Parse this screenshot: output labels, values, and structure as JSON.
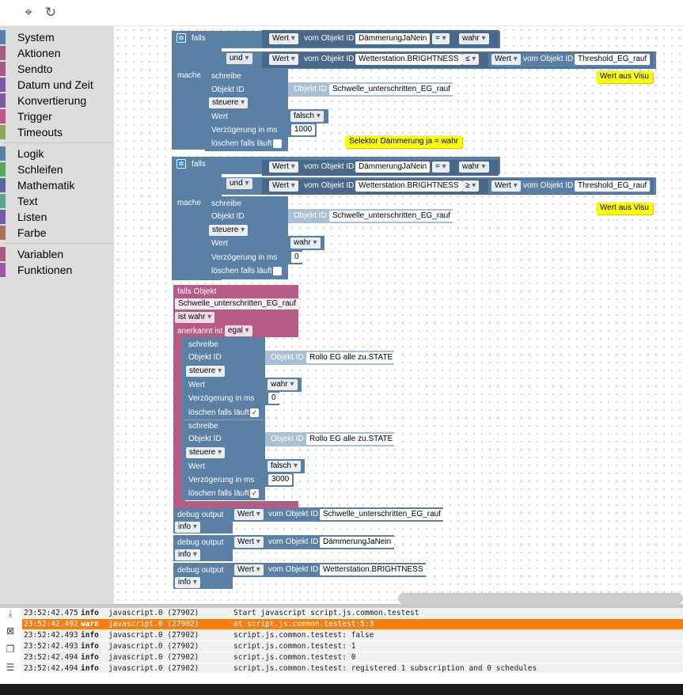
{
  "sidebar": {
    "groups": [
      [
        {
          "label": "System",
          "color": "#5b80a5"
        },
        {
          "label": "Aktionen",
          "color": "#a55b80"
        },
        {
          "label": "Sendto",
          "color": "#a55b80"
        },
        {
          "label": "Datum und Zeit",
          "color": "#7b5ba5"
        },
        {
          "label": "Konvertierung",
          "color": "#7b5ba5"
        },
        {
          "label": "Trigger",
          "color": "#b55b85"
        },
        {
          "label": "Timeouts",
          "color": "#8fa55b"
        }
      ],
      [
        {
          "label": "Logik",
          "color": "#5b80a5"
        },
        {
          "label": "Schleifen",
          "color": "#5ba55b"
        },
        {
          "label": "Mathematik",
          "color": "#5b67a5"
        },
        {
          "label": "Text",
          "color": "#5ba58c"
        },
        {
          "label": "Listen",
          "color": "#745ba5"
        },
        {
          "label": "Farbe",
          "color": "#a5745b"
        }
      ],
      [
        {
          "label": "Variablen",
          "color": "#a55b80"
        },
        {
          "label": "Funktionen",
          "color": "#995ba5"
        }
      ]
    ]
  },
  "blocks": {
    "if1": {
      "falls": "falls",
      "und": "und",
      "mache": "mache",
      "wert1": "Wert",
      "vom1": "vom Objekt ID",
      "obj1": "DämmerungJaNein",
      "op1": "=",
      "val1": "wahr",
      "wert2": "Wert",
      "vom2": "vom Objekt ID",
      "obj2": "Wetterstation.BRIGHTNESS",
      "op2": "≤",
      "wert3": "Wert",
      "vom3": "vom Objekt ID",
      "obj3": "Threshold_EG_rauf",
      "schreibe": "schreibe",
      "objektid": "Objekt ID",
      "objlabel": "Objekt ID",
      "objval": "Schwelle_unterschritten_EG_rauf",
      "steuere": "steuere",
      "wertlbl": "Wert",
      "wertval": "falsch",
      "verz": "Verzögerung in ms",
      "verzval": "1000",
      "loeschen": "löschen falls läuft"
    },
    "if2": {
      "falls": "falls",
      "und": "und",
      "mache": "mache",
      "wert1": "Wert",
      "vom1": "vom Objekt ID",
      "obj1": "DämmerungJaNein",
      "op1": "=",
      "val1": "wahr",
      "wert2": "Wert",
      "vom2": "vom Objekt ID",
      "obj2": "Wetterstation.BRIGHTNESS",
      "op2": "≥",
      "wert3": "Wert",
      "vom3": "vom Objekt ID",
      "obj3": "Threshold_EG_rauf",
      "schreibe": "schreibe",
      "objektid": "Objekt ID",
      "objlabel": "Objekt ID",
      "objval": "Schwelle_unterschritten_EG_rauf",
      "steuere": "steuere",
      "wertlbl": "Wert",
      "wertval": "wahr",
      "verz": "Verzögerung in ms",
      "verzval": "0",
      "loeschen": "löschen falls läuft"
    },
    "trigger": {
      "title": "falls Objekt",
      "obj": "Schwelle_unterschritten_EG_rauf",
      "cond": "ist wahr",
      "anerkannt": "anerkannt ist",
      "anerkanntval": "egal",
      "w1": {
        "schreibe": "schreibe",
        "objektid": "Objekt ID",
        "objlabel": "Objekt ID",
        "objval": "Rollo EG alle zu.STATE",
        "steuere": "steuere",
        "wertlbl": "Wert",
        "wertval": "wahr",
        "verz": "Verzögerung in ms",
        "verzval": "0",
        "loeschen": "löschen falls läuft"
      },
      "w2": {
        "schreibe": "schreibe",
        "objektid": "Objekt ID",
        "objlabel": "Objekt ID",
        "objval": "Rollo EG alle zu.STATE",
        "steuere": "steuere",
        "wertlbl": "Wert",
        "wertval": "falsch",
        "verz": "Verzögerung in ms",
        "verzval": "3000",
        "loeschen": "löschen falls läuft"
      }
    },
    "debug": [
      {
        "label": "debug output",
        "wert": "Wert",
        "vom": "vom Objekt ID",
        "obj": "Schwelle_unterschritten_EG_rauf",
        "level": "info"
      },
      {
        "label": "debug output",
        "wert": "Wert",
        "vom": "vom Objekt ID",
        "obj": "DämmerungJaNein",
        "level": "info"
      },
      {
        "label": "debug output",
        "wert": "Wert",
        "vom": "vom Objekt ID",
        "obj": "Wetterstation.BRIGHTNESS",
        "level": "info"
      }
    ]
  },
  "notes": {
    "n1": "Wert aus Visu",
    "n2": "Selektor Dämmerung ja = wahr",
    "n3": "Wert aus Visu"
  },
  "log": [
    {
      "time": "23:52:42.475",
      "level": "info",
      "src": "javascript.0 (27902)",
      "msg": "Start javascript script.js.common.testest"
    },
    {
      "time": "23:52:42.492",
      "level": "warn",
      "src": "javascript.0 (27902)",
      "msg": "at script.js.common.testest:5:3"
    },
    {
      "time": "23:52:42.493",
      "level": "info",
      "src": "javascript.0 (27902)",
      "msg": "script.js.common.testest: false"
    },
    {
      "time": "23:52:42.493",
      "level": "info",
      "src": "javascript.0 (27902)",
      "msg": "script.js.common.testest: 1"
    },
    {
      "time": "23:52:42.494",
      "level": "info",
      "src": "javascript.0 (27902)",
      "msg": "script.js.common.testest: 0"
    },
    {
      "time": "23:52:42.494",
      "level": "info",
      "src": "javascript.0 (27902)",
      "msg": "script.js.common.testest: registered 1 subscription and 0 schedules"
    }
  ]
}
